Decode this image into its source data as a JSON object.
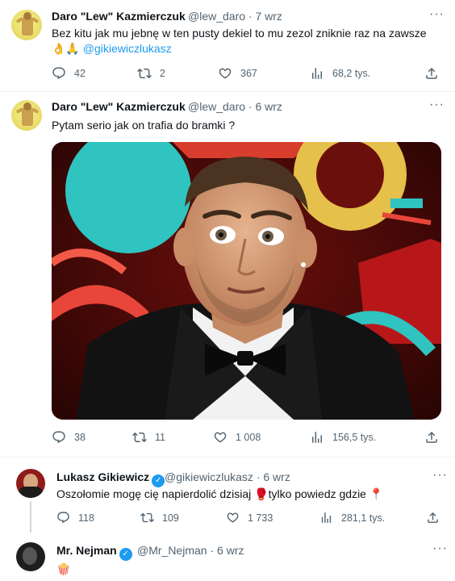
{
  "tweets": [
    {
      "author_name": "Daro \"Lew\" Kazmierczuk",
      "handle": "@lew_daro",
      "time": "7 wrz",
      "text": "Bez kitu jak mu jebnę w ten pusty dekiel to mu zezol zniknie raz na zawsze",
      "emoji": "👌🙏",
      "mention": "@gikiewiczlukasz",
      "replies": "42",
      "retweets": "2",
      "likes": "367",
      "views": "68,2 tys."
    },
    {
      "author_name": "Daro \"Lew\" Kazmierczuk",
      "handle": "@lew_daro",
      "time": "6 wrz",
      "text": "Pytam serio jak on trafia do bramki ?",
      "replies": "38",
      "retweets": "11",
      "likes": "1 008",
      "views": "156,5 tys."
    },
    {
      "author_name": "Lukasz Gikiewicz",
      "handle": "@gikiewiczlukasz",
      "time": "6 wrz",
      "text": "Oszołomie mogę cię napierdolić dzisiaj",
      "emoji_mid": "🥊",
      "text2": "tylko powiedz gdzie",
      "emoji_end": "📍",
      "replies": "118",
      "retweets": "109",
      "likes": "1 733",
      "views": "281,1 tys."
    },
    {
      "author_name": "Mr. Nejman",
      "handle": "@Mr_Nejman",
      "time": "6 wrz",
      "emoji": "🍿"
    }
  ],
  "separator": "·",
  "more_label": "···",
  "colors": {
    "accent": "#1d9bf0",
    "muted": "#536471"
  },
  "icons": [
    "reply-icon",
    "retweet-icon",
    "like-icon",
    "views-icon",
    "share-icon",
    "verified-badge-icon",
    "more-icon"
  ]
}
